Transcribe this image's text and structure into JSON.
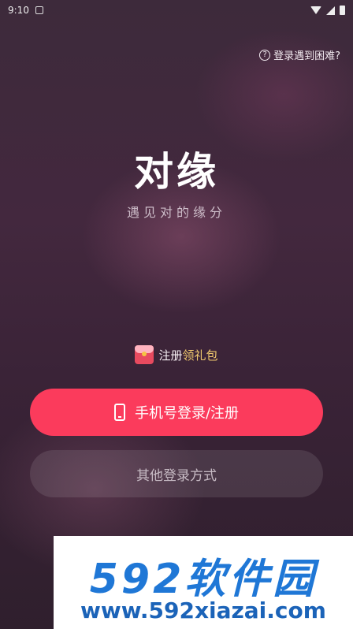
{
  "statusbar": {
    "time": "9:10"
  },
  "help": {
    "label": "登录遇到困难?"
  },
  "brand": {
    "logo": "对缘",
    "slogan": "遇见对的缘分"
  },
  "gift": {
    "text_plain": "注册",
    "text_highlight": "领礼包"
  },
  "buttons": {
    "phone_login": "手机号登录/注册",
    "other_login": "其他登录方式"
  },
  "watermark": {
    "title": "592软件园",
    "url": "www.592xiazai.com"
  },
  "colors": {
    "primary": "#fb3b5c",
    "highlight": "#f0c96e",
    "watermark_blue": "#1f77d6"
  }
}
